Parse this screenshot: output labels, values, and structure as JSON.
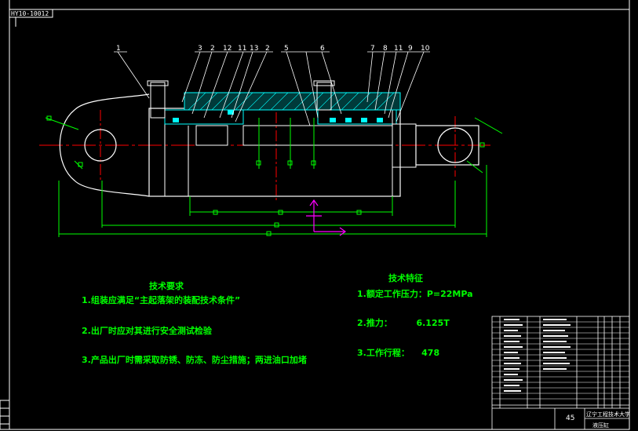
{
  "drawing": {
    "code": "HY10-10012",
    "colors": {
      "background": "#000000",
      "outline": "#ffffff",
      "centerline": "#ff0000",
      "section": "#00ffff",
      "dimension": "#00ff00",
      "leader": "#ffffff",
      "axis": "#ff00ff"
    },
    "part_numbers_left": [
      "1",
      "3",
      "2",
      "12",
      "11",
      "13",
      "2",
      "5"
    ],
    "part_numbers_right": [
      "6",
      "7",
      "8",
      "11",
      "9",
      "10"
    ],
    "tech_requirements": {
      "title": "技术要求",
      "items": [
        "1.组装应满足“主起落架的装配技术条件”",
        "2.出厂时应对其进行安全测试检验",
        "3.产品出厂时需采取防锈、防冻、防尘措施；两进油口加堵"
      ]
    },
    "tech_specs": {
      "title": "技术特征",
      "items": [
        "1.额定工作压力：P=22MPa",
        "2.推力：        6.125T",
        "3.工作行程：    478"
      ]
    },
    "title_block": {
      "scale": "45",
      "school": "辽宁工程技术大学",
      "name": "液压缸"
    }
  }
}
